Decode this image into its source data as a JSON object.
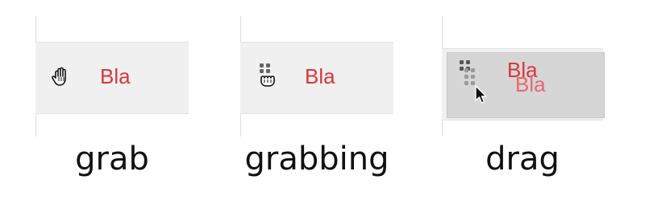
{
  "panels": [
    {
      "item_label": "Bla",
      "caption": "grab",
      "cursor_icon": "hand-open-icon"
    },
    {
      "item_label": "Bla",
      "caption": "grabbing",
      "cursor_icon": "hand-closed-icon"
    },
    {
      "item_label": "Bla",
      "ghost_label": "Bla",
      "caption": "drag",
      "cursor_icon": "arrow-pointer-icon"
    }
  ],
  "colors": {
    "label": "#d9363e",
    "ghost_label": "#e36a70",
    "row_bg": "#f0f0f0",
    "caption": "#111111"
  }
}
